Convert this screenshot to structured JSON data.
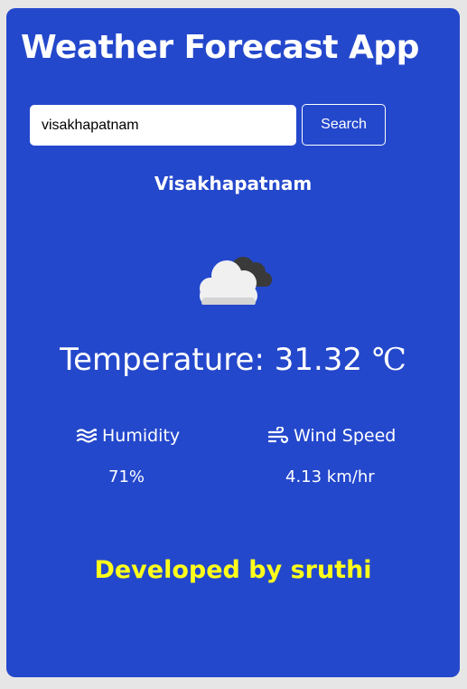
{
  "app": {
    "title": "Weather Forecast App"
  },
  "search": {
    "value": "visakhapatnam",
    "button_label": "Search"
  },
  "weather": {
    "city": "Visakhapatnam",
    "icon": "cloudy-icon",
    "temperature_label": "Temperature:",
    "temperature_value": "31.32",
    "temperature_unit": "℃",
    "humidity": {
      "icon": "humidity-icon",
      "label": "Humidity",
      "value": "71%"
    },
    "wind": {
      "icon": "wind-icon",
      "label": "Wind Speed",
      "value": "4.13 km/hr"
    }
  },
  "footer": {
    "text": "Developed by sruthi"
  },
  "colors": {
    "page_background": "#e6e6e6",
    "card_background": "#2448cc",
    "text": "#ffffff",
    "footer_text": "#ffff1a"
  }
}
